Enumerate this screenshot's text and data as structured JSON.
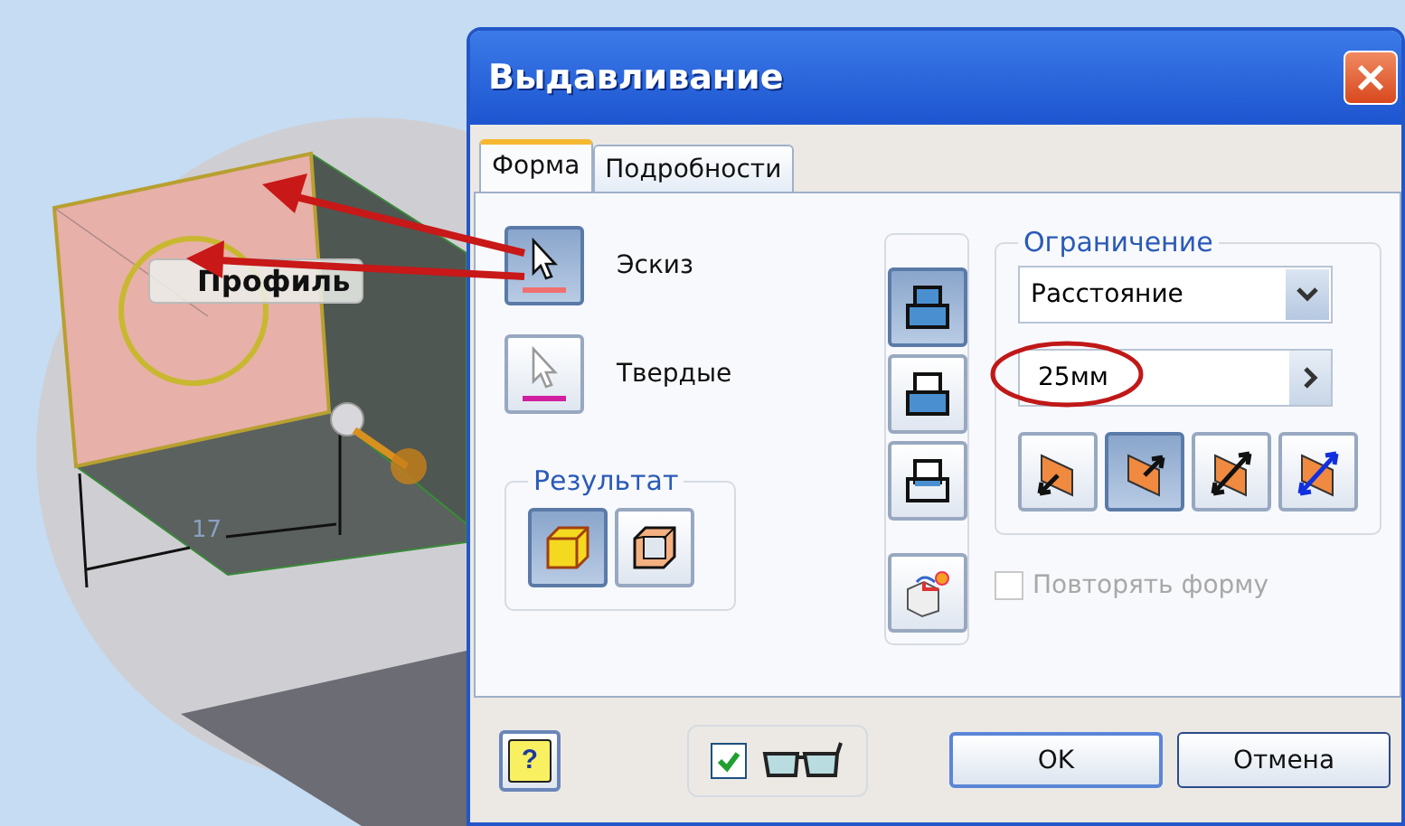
{
  "viewport": {
    "tooltip": "Профиль",
    "dimension": "17"
  },
  "window": {
    "title": "Выдавливание"
  },
  "tabs": [
    {
      "label": "Форма",
      "selected": true
    },
    {
      "label": "Подробности",
      "selected": false
    }
  ],
  "profile_buttons": [
    {
      "kind": "sketch",
      "label": "Эскиз",
      "selected": true
    },
    {
      "kind": "solid",
      "label": "Твердые",
      "selected": false
    }
  ],
  "result": {
    "title": "Результат",
    "options": [
      {
        "kind": "solid",
        "selected": true
      },
      {
        "kind": "surface",
        "selected": false
      }
    ]
  },
  "operations": [
    {
      "kind": "join",
      "selected": true
    },
    {
      "kind": "cut",
      "selected": false
    },
    {
      "kind": "intersect",
      "selected": false
    },
    {
      "kind": "new-solid",
      "selected": false
    }
  ],
  "extents": {
    "title": "Ограничение",
    "type": "Расстояние",
    "distance": "25мм",
    "directions": [
      {
        "kind": "direction1",
        "selected": false
      },
      {
        "kind": "direction2",
        "selected": true
      },
      {
        "kind": "symmetric",
        "selected": false
      },
      {
        "kind": "asymmetric",
        "selected": false
      }
    ]
  },
  "repeat_shape": {
    "label": "Повторять форму",
    "checked": false,
    "disabled": true
  },
  "preview": {
    "checked": true
  },
  "help": {
    "label": "?"
  },
  "buttons": [
    "OK",
    "Отмена"
  ]
}
